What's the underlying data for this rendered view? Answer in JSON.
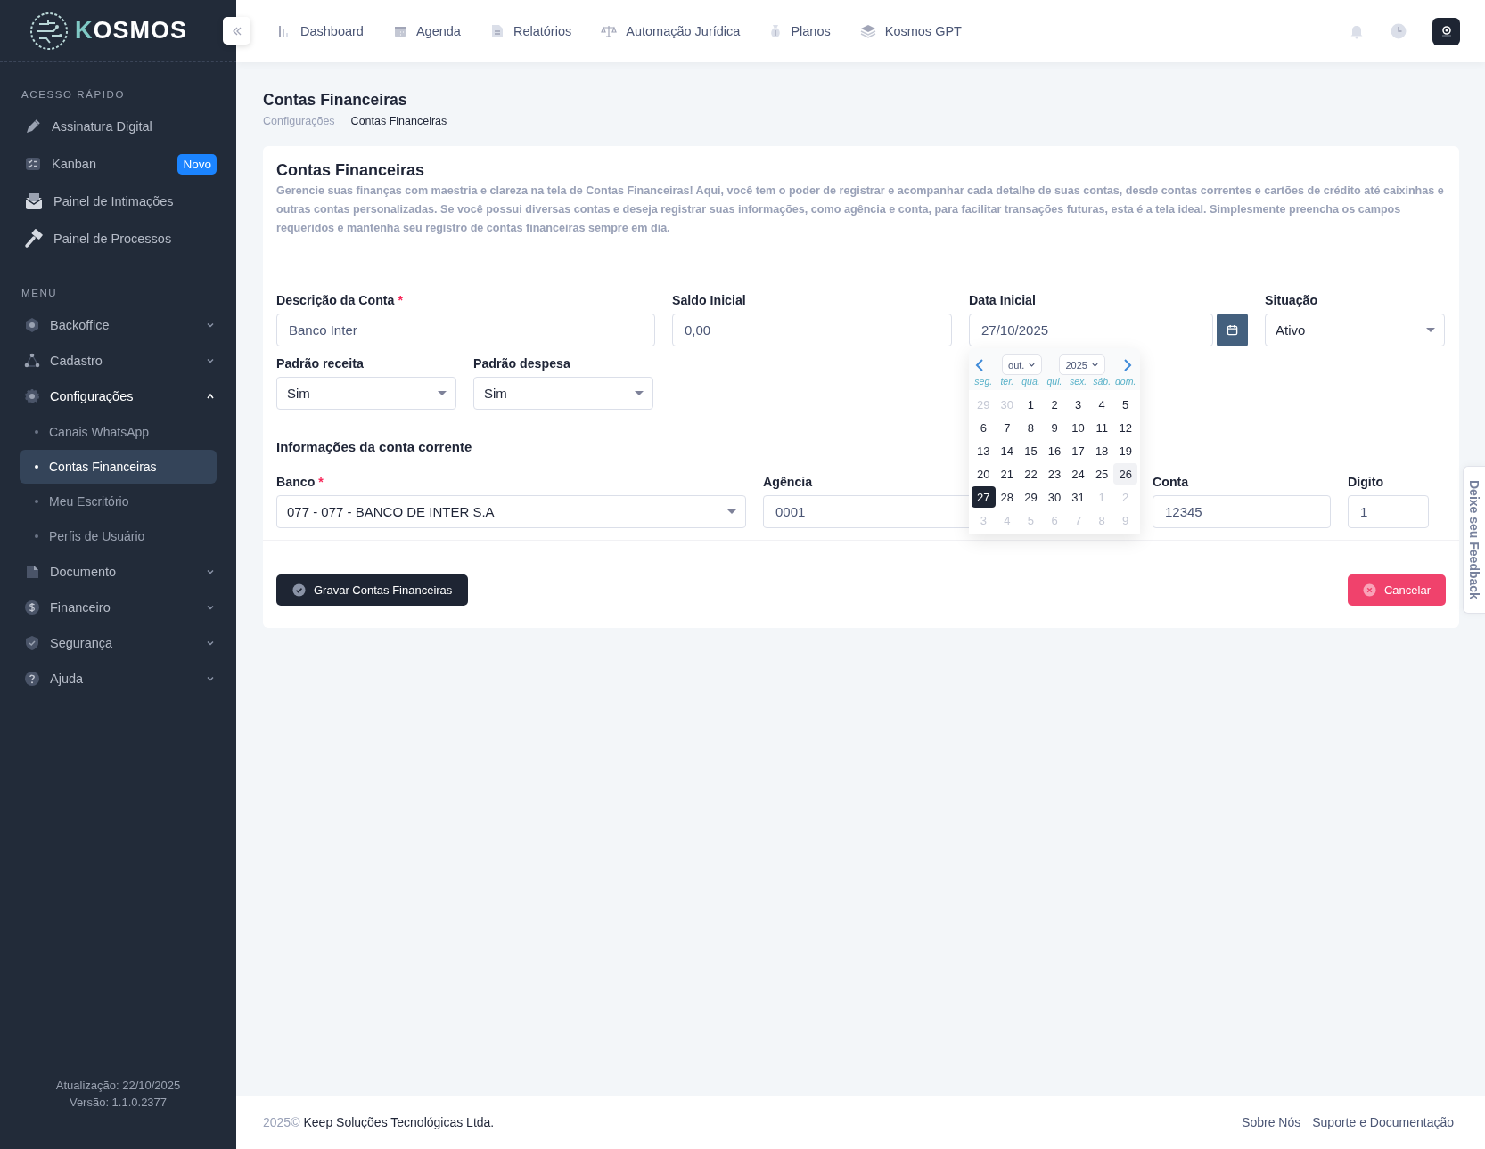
{
  "sidebar": {
    "logo": "KOSMOS",
    "quick_access": {
      "heading": "ACESSO RÁPIDO",
      "items": [
        {
          "label": "Assinatura Digital"
        },
        {
          "label": "Kanban",
          "badge": "Novo"
        },
        {
          "label": "Painel de Intimações"
        },
        {
          "label": "Painel de Processos"
        }
      ]
    },
    "menu": {
      "heading": "MENU",
      "items": [
        {
          "label": "Backoffice",
          "expanded": false
        },
        {
          "label": "Cadastro",
          "expanded": false
        },
        {
          "label": "Configurações",
          "expanded": true,
          "children": [
            {
              "label": "Canais WhatsApp",
              "selected": false
            },
            {
              "label": "Contas Financeiras",
              "selected": true
            },
            {
              "label": "Meu Escritório",
              "selected": false
            },
            {
              "label": "Perfis de Usuário",
              "selected": false
            }
          ]
        },
        {
          "label": "Documento",
          "expanded": false
        },
        {
          "label": "Financeiro",
          "expanded": false
        },
        {
          "label": "Segurança",
          "expanded": false
        },
        {
          "label": "Ajuda",
          "expanded": false
        }
      ]
    },
    "footer": [
      "Atualização: 22/10/2025",
      "Versão: 1.1.0.2377"
    ]
  },
  "topbar": {
    "nav": [
      "Dashboard",
      "Agenda",
      "Relatórios",
      "Automação Jurídica",
      "Planos",
      "Kosmos GPT"
    ]
  },
  "page": {
    "title": "Contas Financeiras",
    "breadcrumb": [
      {
        "label": "Configurações",
        "current": false
      },
      {
        "label": "Contas Financeiras",
        "current": true
      }
    ]
  },
  "card": {
    "title": "Contas Financeiras",
    "description": "Gerencie suas finanças com maestria e clareza na tela de Contas Financeiras! Aqui, você tem o poder de registrar e acompanhar cada detalhe de suas contas, desde contas correntes e cartões de crédito até caixinhas e outras contas personalizadas. Se você possui diversas contas e deseja registrar suas informações, como agência e conta, para facilitar transações futuras, esta é a tela ideal. Simplesmente preencha os campos requeridos e mantenha seu registro de contas financeiras sempre em dia.",
    "rows": [
      [
        {
          "kind": "text",
          "label": "Descrição da Conta",
          "required_mark": "*",
          "value": "Banco Inter"
        },
        {
          "kind": "text",
          "label": "Saldo Inicial",
          "value": "0,00"
        },
        {
          "kind": "date",
          "label": "Data Inicial",
          "value": "27/10/2025"
        },
        {
          "kind": "select",
          "label": "Situação",
          "value": "Ativo"
        }
      ],
      [
        {
          "kind": "select",
          "label": "Padrão receita",
          "value": "Sim"
        },
        {
          "kind": "select",
          "label": "Padrão despesa",
          "value": "Sim"
        }
      ]
    ],
    "section_title": "Informações da conta corrente",
    "bank_row": [
      {
        "kind": "select",
        "label": "Banco",
        "required_mark": "*",
        "value": "077 - 077 - BANCO DE INTER S.A"
      },
      {
        "kind": "text",
        "label": "Agência",
        "value": "0001"
      },
      {
        "kind": "text",
        "label": "Conta",
        "value": "12345"
      },
      {
        "kind": "text",
        "label": "Dígito",
        "value": "1"
      }
    ],
    "buttons": [
      {
        "kind": "primary",
        "label": "Gravar Contas Financeiras"
      },
      {
        "kind": "danger",
        "label": "Cancelar"
      }
    ]
  },
  "datepicker": {
    "month": "out.",
    "year": "2025",
    "weekdays": [
      "seg.",
      "ter.",
      "qua.",
      "qui.",
      "sex.",
      "sáb.",
      "dom."
    ],
    "days": [
      {
        "d": "29",
        "outside": true,
        "selected": false,
        "highlighted": false
      },
      {
        "d": "30",
        "outside": true,
        "selected": false,
        "highlighted": false
      },
      {
        "d": "1",
        "outside": false,
        "selected": false,
        "highlighted": false
      },
      {
        "d": "2",
        "outside": false,
        "selected": false,
        "highlighted": false
      },
      {
        "d": "3",
        "outside": false,
        "selected": false,
        "highlighted": false
      },
      {
        "d": "4",
        "outside": false,
        "selected": false,
        "highlighted": false
      },
      {
        "d": "5",
        "outside": false,
        "selected": false,
        "highlighted": false
      },
      {
        "d": "6",
        "outside": false,
        "selected": false,
        "highlighted": false
      },
      {
        "d": "7",
        "outside": false,
        "selected": false,
        "highlighted": false
      },
      {
        "d": "8",
        "outside": false,
        "selected": false,
        "highlighted": false
      },
      {
        "d": "9",
        "outside": false,
        "selected": false,
        "highlighted": false
      },
      {
        "d": "10",
        "outside": false,
        "selected": false,
        "highlighted": false
      },
      {
        "d": "11",
        "outside": false,
        "selected": false,
        "highlighted": false
      },
      {
        "d": "12",
        "outside": false,
        "selected": false,
        "highlighted": false
      },
      {
        "d": "13",
        "outside": false,
        "selected": false,
        "highlighted": false
      },
      {
        "d": "14",
        "outside": false,
        "selected": false,
        "highlighted": false
      },
      {
        "d": "15",
        "outside": false,
        "selected": false,
        "highlighted": false
      },
      {
        "d": "16",
        "outside": false,
        "selected": false,
        "highlighted": false
      },
      {
        "d": "17",
        "outside": false,
        "selected": false,
        "highlighted": false
      },
      {
        "d": "18",
        "outside": false,
        "selected": false,
        "highlighted": false
      },
      {
        "d": "19",
        "outside": false,
        "selected": false,
        "highlighted": false
      },
      {
        "d": "20",
        "outside": false,
        "selected": false,
        "highlighted": false
      },
      {
        "d": "21",
        "outside": false,
        "selected": false,
        "highlighted": false
      },
      {
        "d": "22",
        "outside": false,
        "selected": false,
        "highlighted": false
      },
      {
        "d": "23",
        "outside": false,
        "selected": false,
        "highlighted": false
      },
      {
        "d": "24",
        "outside": false,
        "selected": false,
        "highlighted": false
      },
      {
        "d": "25",
        "outside": false,
        "selected": false,
        "highlighted": false
      },
      {
        "d": "26",
        "outside": false,
        "selected": false,
        "highlighted": true
      },
      {
        "d": "27",
        "outside": false,
        "selected": true,
        "highlighted": false
      },
      {
        "d": "28",
        "outside": false,
        "selected": false,
        "highlighted": false
      },
      {
        "d": "29",
        "outside": false,
        "selected": false,
        "highlighted": false
      },
      {
        "d": "30",
        "outside": false,
        "selected": false,
        "highlighted": false
      },
      {
        "d": "31",
        "outside": false,
        "selected": false,
        "highlighted": false
      },
      {
        "d": "1",
        "outside": true,
        "selected": false,
        "highlighted": false
      },
      {
        "d": "2",
        "outside": true,
        "selected": false,
        "highlighted": false
      },
      {
        "d": "3",
        "outside": true,
        "selected": false,
        "highlighted": false
      },
      {
        "d": "4",
        "outside": true,
        "selected": false,
        "highlighted": false
      },
      {
        "d": "5",
        "outside": true,
        "selected": false,
        "highlighted": false
      },
      {
        "d": "6",
        "outside": true,
        "selected": false,
        "highlighted": false
      },
      {
        "d": "7",
        "outside": true,
        "selected": false,
        "highlighted": false
      },
      {
        "d": "8",
        "outside": true,
        "selected": false,
        "highlighted": false
      },
      {
        "d": "9",
        "outside": true,
        "selected": false,
        "highlighted": false
      }
    ]
  },
  "footer": {
    "year": "2025©",
    "company": "Keep Soluções Tecnológicas Ltda.",
    "links": [
      "Sobre Nós",
      "Suporte e Documentação"
    ]
  },
  "feedback_tab": "Deixe seu Feedback"
}
